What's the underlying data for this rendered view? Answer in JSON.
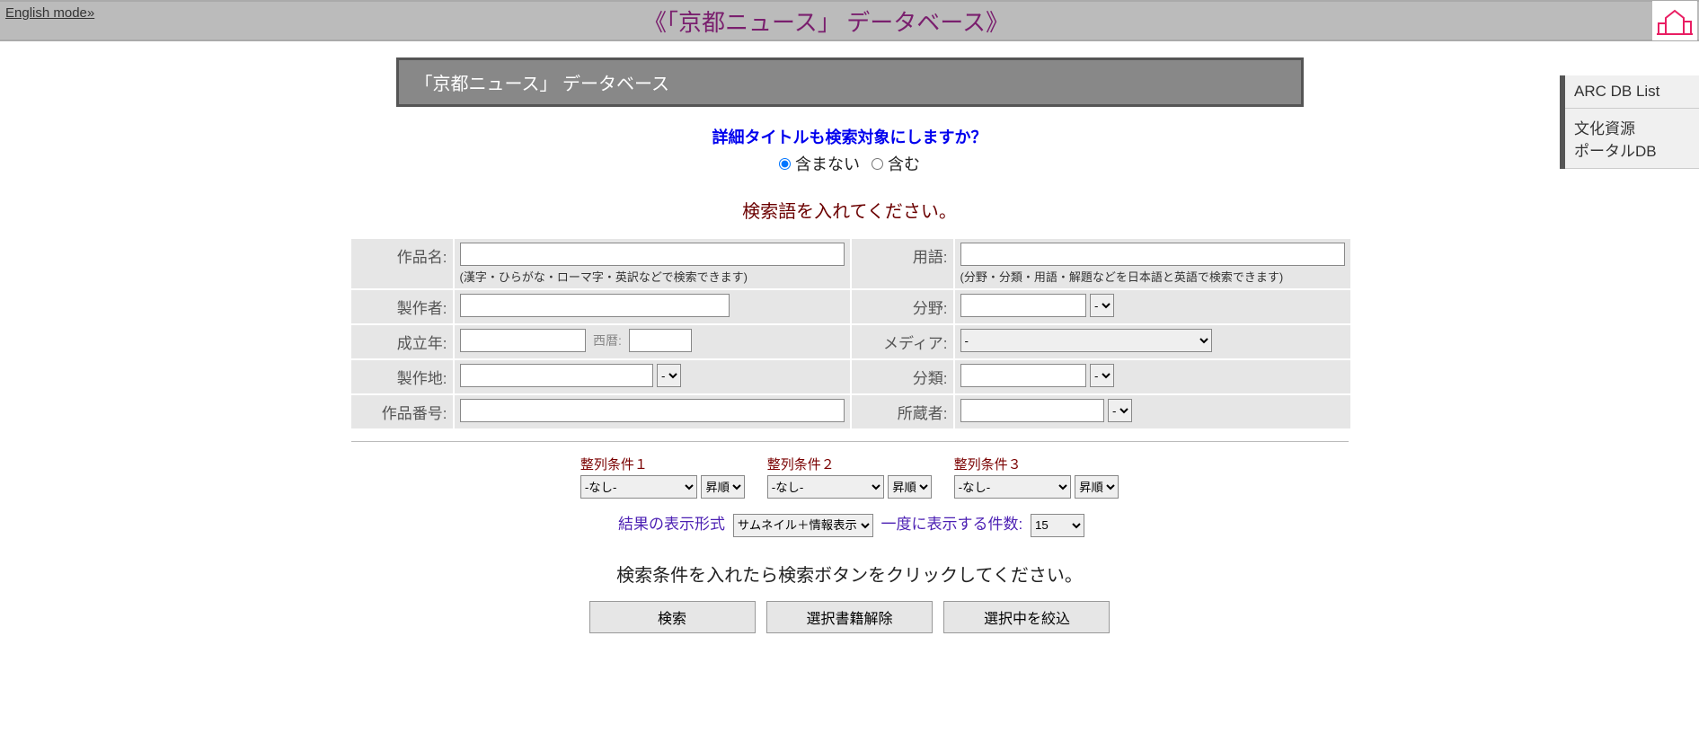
{
  "header": {
    "english_link": "English mode»",
    "title": "《「京都ニュース」 データベース》"
  },
  "side_menu": {
    "item1": "ARC DB List",
    "item2": "文化資源\nポータルDB"
  },
  "sub_banner": "「京都ニュース」 データベース",
  "prompt_blue": "詳細タイトルも検索対象にしますか？",
  "radio": {
    "opt1": "含まない",
    "opt2": "含む"
  },
  "prompt_red": "検索語を入れてください。",
  "fields": {
    "title_label": "作品名:",
    "title_hint": "(漢字・ひらがな・ローマ字・英訳などで検索できます)",
    "term_label": "用語:",
    "term_hint": "(分野・分類・用語・解題などを日本語と英語で検索できます)",
    "maker_label": "製作者:",
    "field_label": "分野:",
    "year_label": "成立年:",
    "year_inline": "西暦:",
    "media_label": "メディア:",
    "place_label": "製作地:",
    "class_label": "分類:",
    "workno_label": "作品番号:",
    "owner_label": "所蔵者:",
    "dash_opt": "-"
  },
  "sort": {
    "label1": "整列条件１",
    "label2": "整列条件２",
    "label3": "整列条件３",
    "none_opt": "-なし-",
    "asc_opt": "昇順"
  },
  "display": {
    "fmt_label": "結果の表示形式",
    "fmt_opt": "サムネイル＋情報表示",
    "count_label": "一度に表示する件数:",
    "count_opt": "15"
  },
  "instr": "検索条件を入れたら検索ボタンをクリックしてください。",
  "buttons": {
    "search": "検索",
    "clear": "選択書籍解除",
    "refine": "選択中を絞込"
  }
}
